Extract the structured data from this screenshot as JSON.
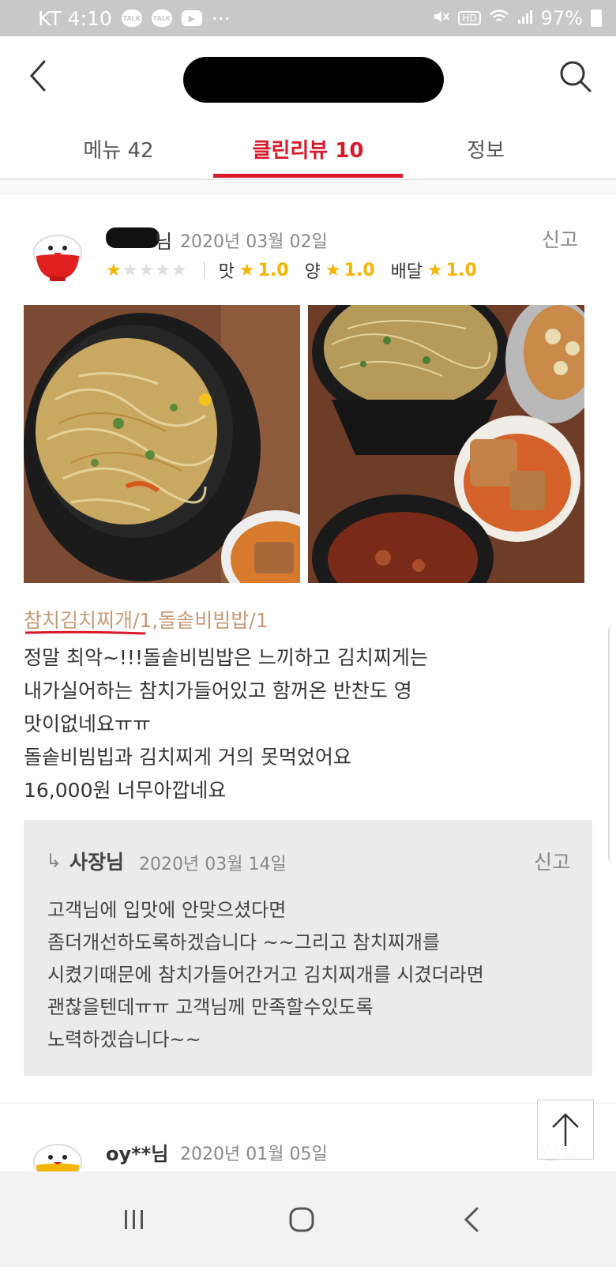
{
  "status_bar": {
    "carrier_time": "KT 4:10",
    "icons": [
      "talk-icon",
      "talk-icon",
      "play-icon",
      "more-dots-icon"
    ],
    "talk_label": "TALK",
    "dots": "···",
    "hd_label": "HD",
    "battery": "97%"
  },
  "header": {
    "back_icon": "chevron-left-icon",
    "search_icon": "search-icon"
  },
  "tabs": [
    {
      "label": "메뉴 42",
      "active": false
    },
    {
      "label": "클린리뷰 10",
      "active": true
    },
    {
      "label": "정보",
      "active": false
    }
  ],
  "review": {
    "author_suffix": "님",
    "date": "2020년 03월 02일",
    "report": "신고",
    "rating_stars": 1,
    "scores": [
      {
        "label": "맛",
        "value": "1.0"
      },
      {
        "label": "양",
        "value": "1.0"
      },
      {
        "label": "배달",
        "value": "1.0"
      }
    ],
    "menu_tags": "참치김치찌개/1,돌솥비빔밥/1",
    "body": [
      "정말 최악~!!!돌솥비빔밥은 느끼하고 김치찌게는",
      "내가실어하는 참치가들어있고 함꺼온 반찬도 영",
      "맛이없네요ㅠㅠ",
      "돌솥비빔빕과 김치찌게 거의 못먹었어요",
      "16,000원 너무아깝네요"
    ],
    "reply": {
      "arrow": "↳",
      "author": "사장님",
      "date": "2020년 03월 14일",
      "report": "신고",
      "body": [
        "고객님에 입맛에 안맞으셨다면",
        "좀더개선하도록하겠습니다 ~~그리고 참치찌개를",
        "시켰기때문에 참치가들어간거고 김치찌개를 시겼더라면",
        "괜찮을텐데ㅠㅠ 고객님께 만족할수있도록",
        "노력하겠습니다~~"
      ]
    }
  },
  "review2": {
    "author": "oy**님",
    "date": "2020년 01월 05일",
    "report": "신고"
  },
  "colors": {
    "accent": "#d8192b",
    "star": "#f5b400",
    "menu_tag": "#c79a74"
  }
}
